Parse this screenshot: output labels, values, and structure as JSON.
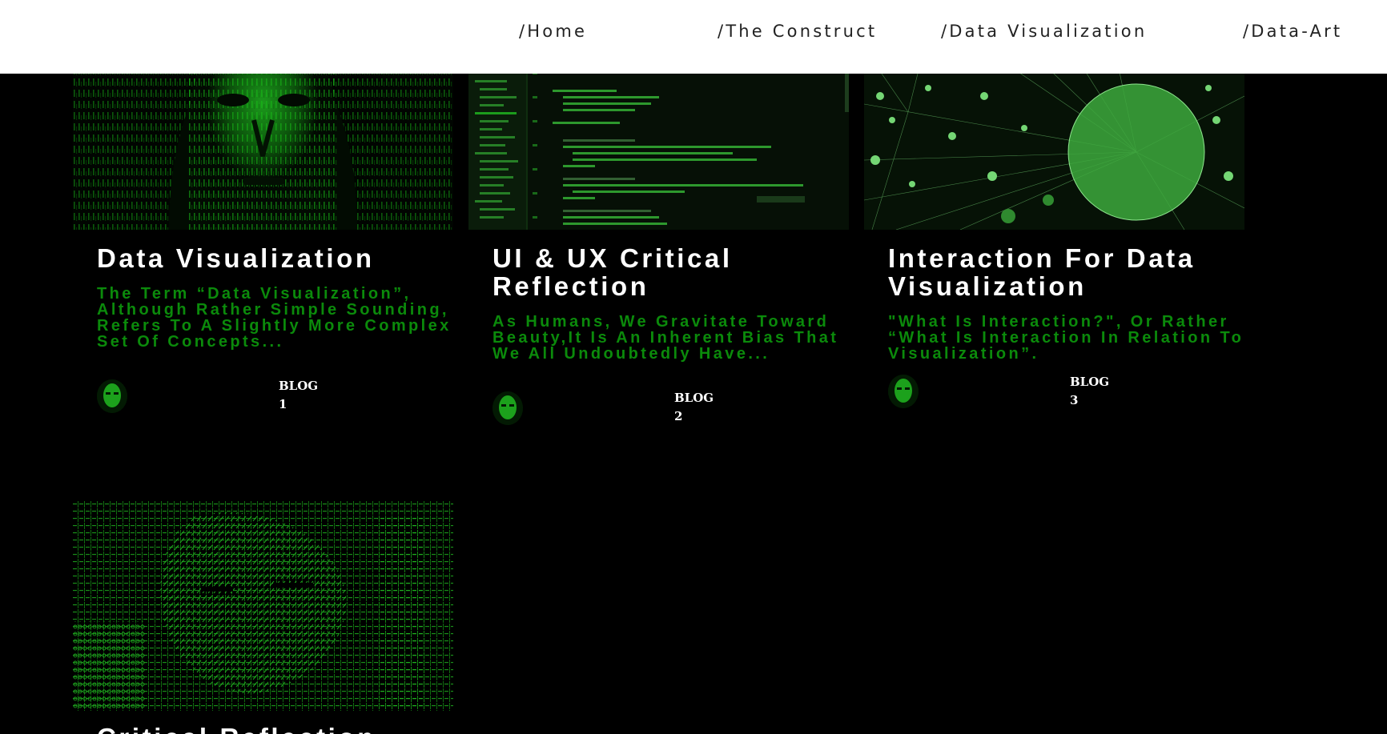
{
  "nav": {
    "items": [
      {
        "label": "/Home"
      },
      {
        "label": "/The Construct"
      },
      {
        "label": "/Data Visualization"
      },
      {
        "label": "/Data-Art"
      }
    ]
  },
  "posts": [
    {
      "title": "Data Visualization",
      "excerpt": "The Term “Data Visualization”, Although Rather Simple Sounding, Refers To A Slightly More Complex Set Of Concepts...",
      "category": "BLOG",
      "number": "1"
    },
    {
      "title": "UI & UX Critical Reflection",
      "excerpt": "As Humans, We Gravitate Toward Beauty,It Is An Inherent Bias That We All Undoubtedly Have...",
      "category": "BLOG",
      "number": "2"
    },
    {
      "title": "Interaction For Data Visualization",
      "excerpt": "\"What Is Interaction?\", Or Rather “What Is Interaction In Relation To Visualization”.",
      "category": "BLOG",
      "number": "3"
    },
    {
      "title": "Critical Reflection"
    }
  ],
  "colors": {
    "accent_green": "#0b8a0b",
    "background": "#000000",
    "nav_background": "#ffffff"
  }
}
